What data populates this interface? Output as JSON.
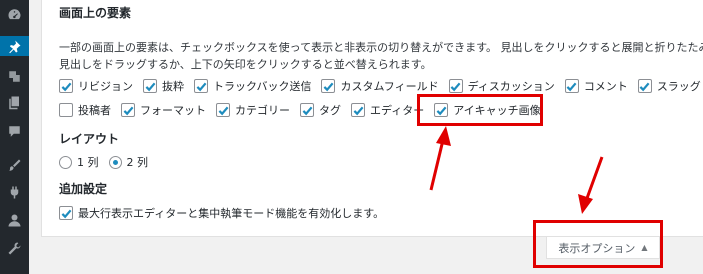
{
  "sidebar": {
    "icons": [
      "speedometer-icon",
      "pin-icon",
      "media-icon",
      "pages-icon",
      "comments-icon",
      "brush-icon",
      "plugin-icon",
      "user-icon",
      "wrench-icon"
    ]
  },
  "screen_options": {
    "title": "画面上の要素",
    "description_line1": "一部の画面上の要素は、チェックボックスを使って表示と非表示の切り替えができます。 見出しをクリックすると展開と折りたたみを",
    "description_line2": "見出しをドラッグするか、上下の矢印をクリックすると並べ替えられます。",
    "checkboxes_row1": [
      {
        "label": "リビジョン",
        "checked": true
      },
      {
        "label": "抜粋",
        "checked": true
      },
      {
        "label": "トラックバック送信",
        "checked": true
      },
      {
        "label": "カスタムフィールド",
        "checked": true
      },
      {
        "label": "ディスカッション",
        "checked": true
      },
      {
        "label": "コメント",
        "checked": true
      },
      {
        "label": "スラッグ",
        "checked": true
      }
    ],
    "checkboxes_row2": [
      {
        "label": "投稿者",
        "checked": false
      },
      {
        "label": "フォーマット",
        "checked": true
      },
      {
        "label": "カテゴリー",
        "checked": true
      },
      {
        "label": "タグ",
        "checked": true
      },
      {
        "label": "エディター",
        "checked": true
      },
      {
        "label": "アイキャッチ画像",
        "checked": true
      }
    ],
    "layout_title": "レイアウト",
    "layout_options": [
      {
        "label": "1 列",
        "selected": false
      },
      {
        "label": "2 列",
        "selected": true
      }
    ],
    "additional_title": "追加設定",
    "additional_option": {
      "label": "最大行表示エディターと集中執筆モード機能を有効化します。",
      "checked": true
    },
    "tab_label": "表示オプション",
    "tab_arrow": "▲"
  },
  "colors": {
    "admin_bar": "#23282d",
    "active_menu": "#0073aa",
    "checkmark": "#1e8cbe",
    "annotation": "#e00000"
  }
}
